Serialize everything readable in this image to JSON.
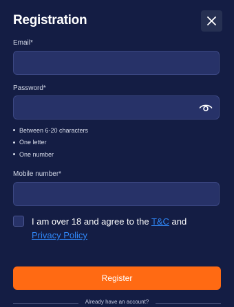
{
  "header": {
    "title": "Registration",
    "close_icon": "close-icon"
  },
  "email": {
    "label": "Email*",
    "value": "",
    "placeholder": ""
  },
  "password": {
    "label": "Password*",
    "value": "",
    "placeholder": "",
    "toggle_icon": "eye-icon",
    "rules": [
      "Between 6-20 characters",
      "One letter",
      "One number"
    ]
  },
  "mobile": {
    "label": "Mobile number*",
    "value": "",
    "placeholder": ""
  },
  "agreement": {
    "checked": false,
    "text_before": "I am over 18 and agree to the ",
    "tc_link": "T&C",
    "text_middle": " and ",
    "privacy_link": "Privacy Policy"
  },
  "actions": {
    "register_label": "Register",
    "already_text": "Already have an account?"
  },
  "colors": {
    "background": "#141d44",
    "input_bg": "#273268",
    "accent": "#ff6a13",
    "link": "#2f86f6"
  }
}
